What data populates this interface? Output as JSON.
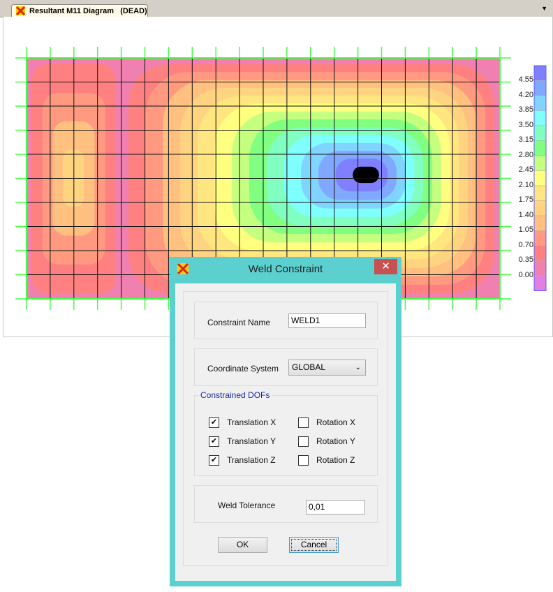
{
  "tab": {
    "title": "Resultant M11 Diagram   (DEAD)",
    "icon": "sap-logo-icon"
  },
  "legend": {
    "labels": [
      "4.55",
      "4.20",
      "3.85",
      "3.50",
      "3.15",
      "2.80",
      "2.45",
      "2.10",
      "1.75",
      "1.40",
      "1.05",
      "0.70",
      "0.35",
      "0.00"
    ],
    "colors": [
      "#8080ff",
      "#80a8ff",
      "#80d4ff",
      "#80ffff",
      "#80ffc0",
      "#80ff80",
      "#c4ff80",
      "#ffff80",
      "#ffe680",
      "#ffd480",
      "#ffc080",
      "#ff9a80",
      "#ff8080",
      "#f080b0",
      "#e080e0"
    ]
  },
  "dialog": {
    "title": "Weld Constraint",
    "close": "✕",
    "constraint_name_label": "Constraint Name",
    "constraint_name_value": "WELD1",
    "coord_label": "Coordinate System",
    "coord_value": "GLOBAL",
    "dofs_title": "Constrained DOFs",
    "dofs": [
      {
        "label": "Translation X",
        "checked": true
      },
      {
        "label": "Translation Y",
        "checked": true
      },
      {
        "label": "Translation Z",
        "checked": true
      },
      {
        "label": "Rotation X",
        "checked": false
      },
      {
        "label": "Rotation Y",
        "checked": false
      },
      {
        "label": "Rotation Z",
        "checked": false
      }
    ],
    "tolerance_label": "Weld Tolerance",
    "tolerance_value": "0,01",
    "ok": "OK",
    "cancel": "Cancel"
  }
}
